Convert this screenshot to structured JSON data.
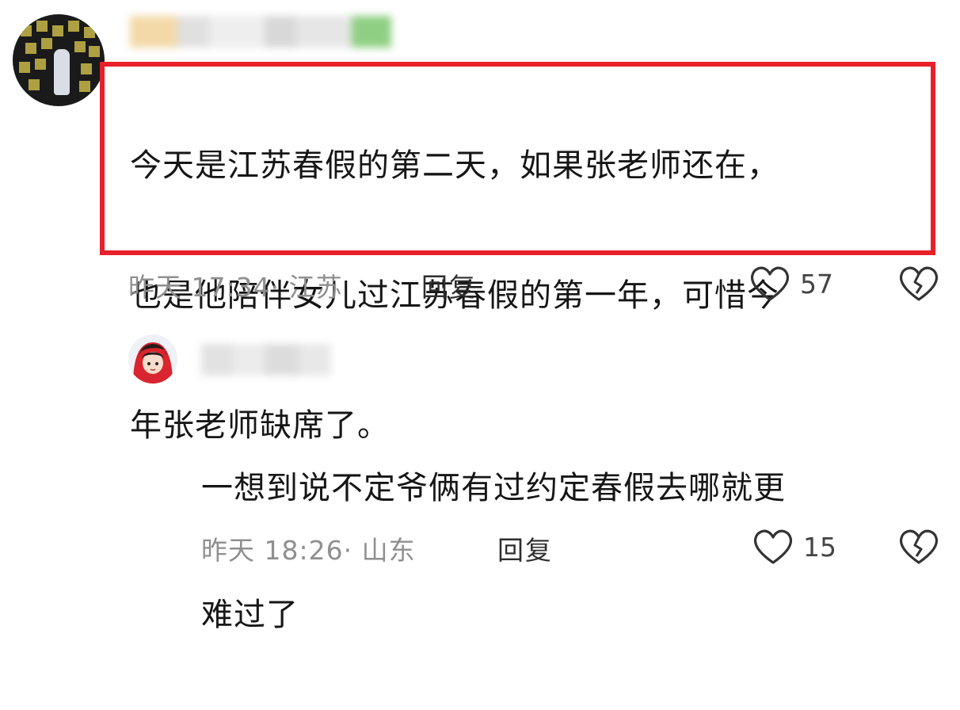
{
  "comment": {
    "text_lines": [
      "今天是江苏春假的第二天，如果张老师还在，",
      "也是他陪伴女儿过江苏春假的第一年，可惜今",
      "年张老师缺席了。"
    ],
    "time": "昨天 17:34·",
    "location": "江苏",
    "reply_label": "回复",
    "like_count": "57",
    "highlight_color": "#e8202a"
  },
  "reply": {
    "text_lines": [
      "一想到说不定爷俩有过约定春假去哪就更",
      "难过了"
    ],
    "time": "昨天 18:26·",
    "location": "山东",
    "reply_label": "回复",
    "like_count": "15"
  },
  "icons": {
    "like": "heart-outline-icon",
    "dislike": "broken-heart-icon"
  }
}
